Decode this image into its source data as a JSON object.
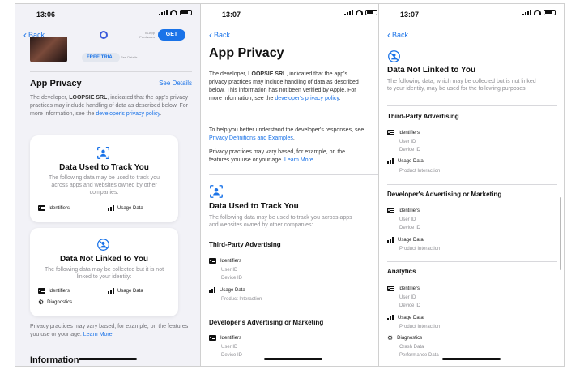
{
  "colors": {
    "accent": "#1a73e8",
    "secondary_text": "#8e8e93"
  },
  "phone1": {
    "time": "13:06",
    "back_label": "Back",
    "get_label": "GET",
    "in_app_label": "In-App Purchases",
    "free_trial_label": "FREE TRIAL",
    "see_details_small": "See Details",
    "section_title": "App Privacy",
    "see_details": "See Details",
    "desc_prefix": "The developer, ",
    "developer_name": "LOOPSIE SRL",
    "desc_suffix": ", indicated that the app's privacy practices may include handling of data as described below. For more information, see the ",
    "policy_link": "developer's privacy policy",
    "desc_end": ".",
    "card1": {
      "title": "Data Used to Track You",
      "desc": "The following data may be used to track you across apps and websites owned by other companies:",
      "item1": "Identifiers",
      "item2": "Usage Data"
    },
    "card2": {
      "title": "Data Not Linked to You",
      "desc": "The following data may be collected but it is not linked to your identity:",
      "item1": "Identifiers",
      "item2": "Usage Data",
      "item3": "Diagnostics"
    },
    "footer_text": "Privacy practices may vary based, for example, on the features you use or your age. ",
    "learn_more": "Learn More",
    "info_title": "Information"
  },
  "phone2": {
    "time": "13:07",
    "back_label": "Back",
    "title": "App Privacy",
    "desc_prefix": "The developer, ",
    "developer_name": "LOOPSIE SRL",
    "desc_suffix": ", indicated that the app's privacy practices may include handling of data as described below. This information has not been verified by Apple. For more information, see the ",
    "policy_link": "developer's privacy policy",
    "desc_end": ".",
    "help_prefix": "To help you better understand the developer's responses, see ",
    "help_link": "Privacy Definitions and Examples",
    "help_end": ".",
    "vary_text": "Privacy practices may vary based, for example, on the features you use or your age. ",
    "learn_more": "Learn More",
    "track_title": "Data Used to Track You",
    "track_desc": "The following data may be used to track you across apps and websites owned by other companies:",
    "third_party": "Third-Party Advertising",
    "identifiers": "Identifiers",
    "user_id": "User ID",
    "device_id": "Device ID",
    "usage_data": "Usage Data",
    "product_interaction": "Product Interaction",
    "dev_advertising": "Developer's Advertising or Marketing",
    "identifiers2": "Identifiers",
    "user_id2": "User ID",
    "device_id2": "Device ID"
  },
  "phone3": {
    "time": "13:07",
    "back_label": "Back",
    "title": "Data Not Linked to You",
    "desc": "The following data, which may be collected but is not linked to your identity, may be used for the following purposes:",
    "third_party": "Third-Party Advertising",
    "tp_identifiers": "Identifiers",
    "tp_user_id": "User ID",
    "tp_device_id": "Device ID",
    "tp_usage": "Usage Data",
    "tp_product": "Product Interaction",
    "dev_advertising": "Developer's Advertising or Marketing",
    "da_identifiers": "Identifiers",
    "da_user_id": "User ID",
    "da_device_id": "Device ID",
    "da_usage": "Usage Data",
    "da_product": "Product Interaction",
    "analytics": "Analytics",
    "an_identifiers": "Identifiers",
    "an_user_id": "User ID",
    "an_device_id": "Device ID",
    "an_usage": "Usage Data",
    "an_product": "Product Interaction",
    "an_diagnostics": "Diagnostics",
    "an_crash": "Crash Data",
    "an_performance": "Performance Data"
  }
}
